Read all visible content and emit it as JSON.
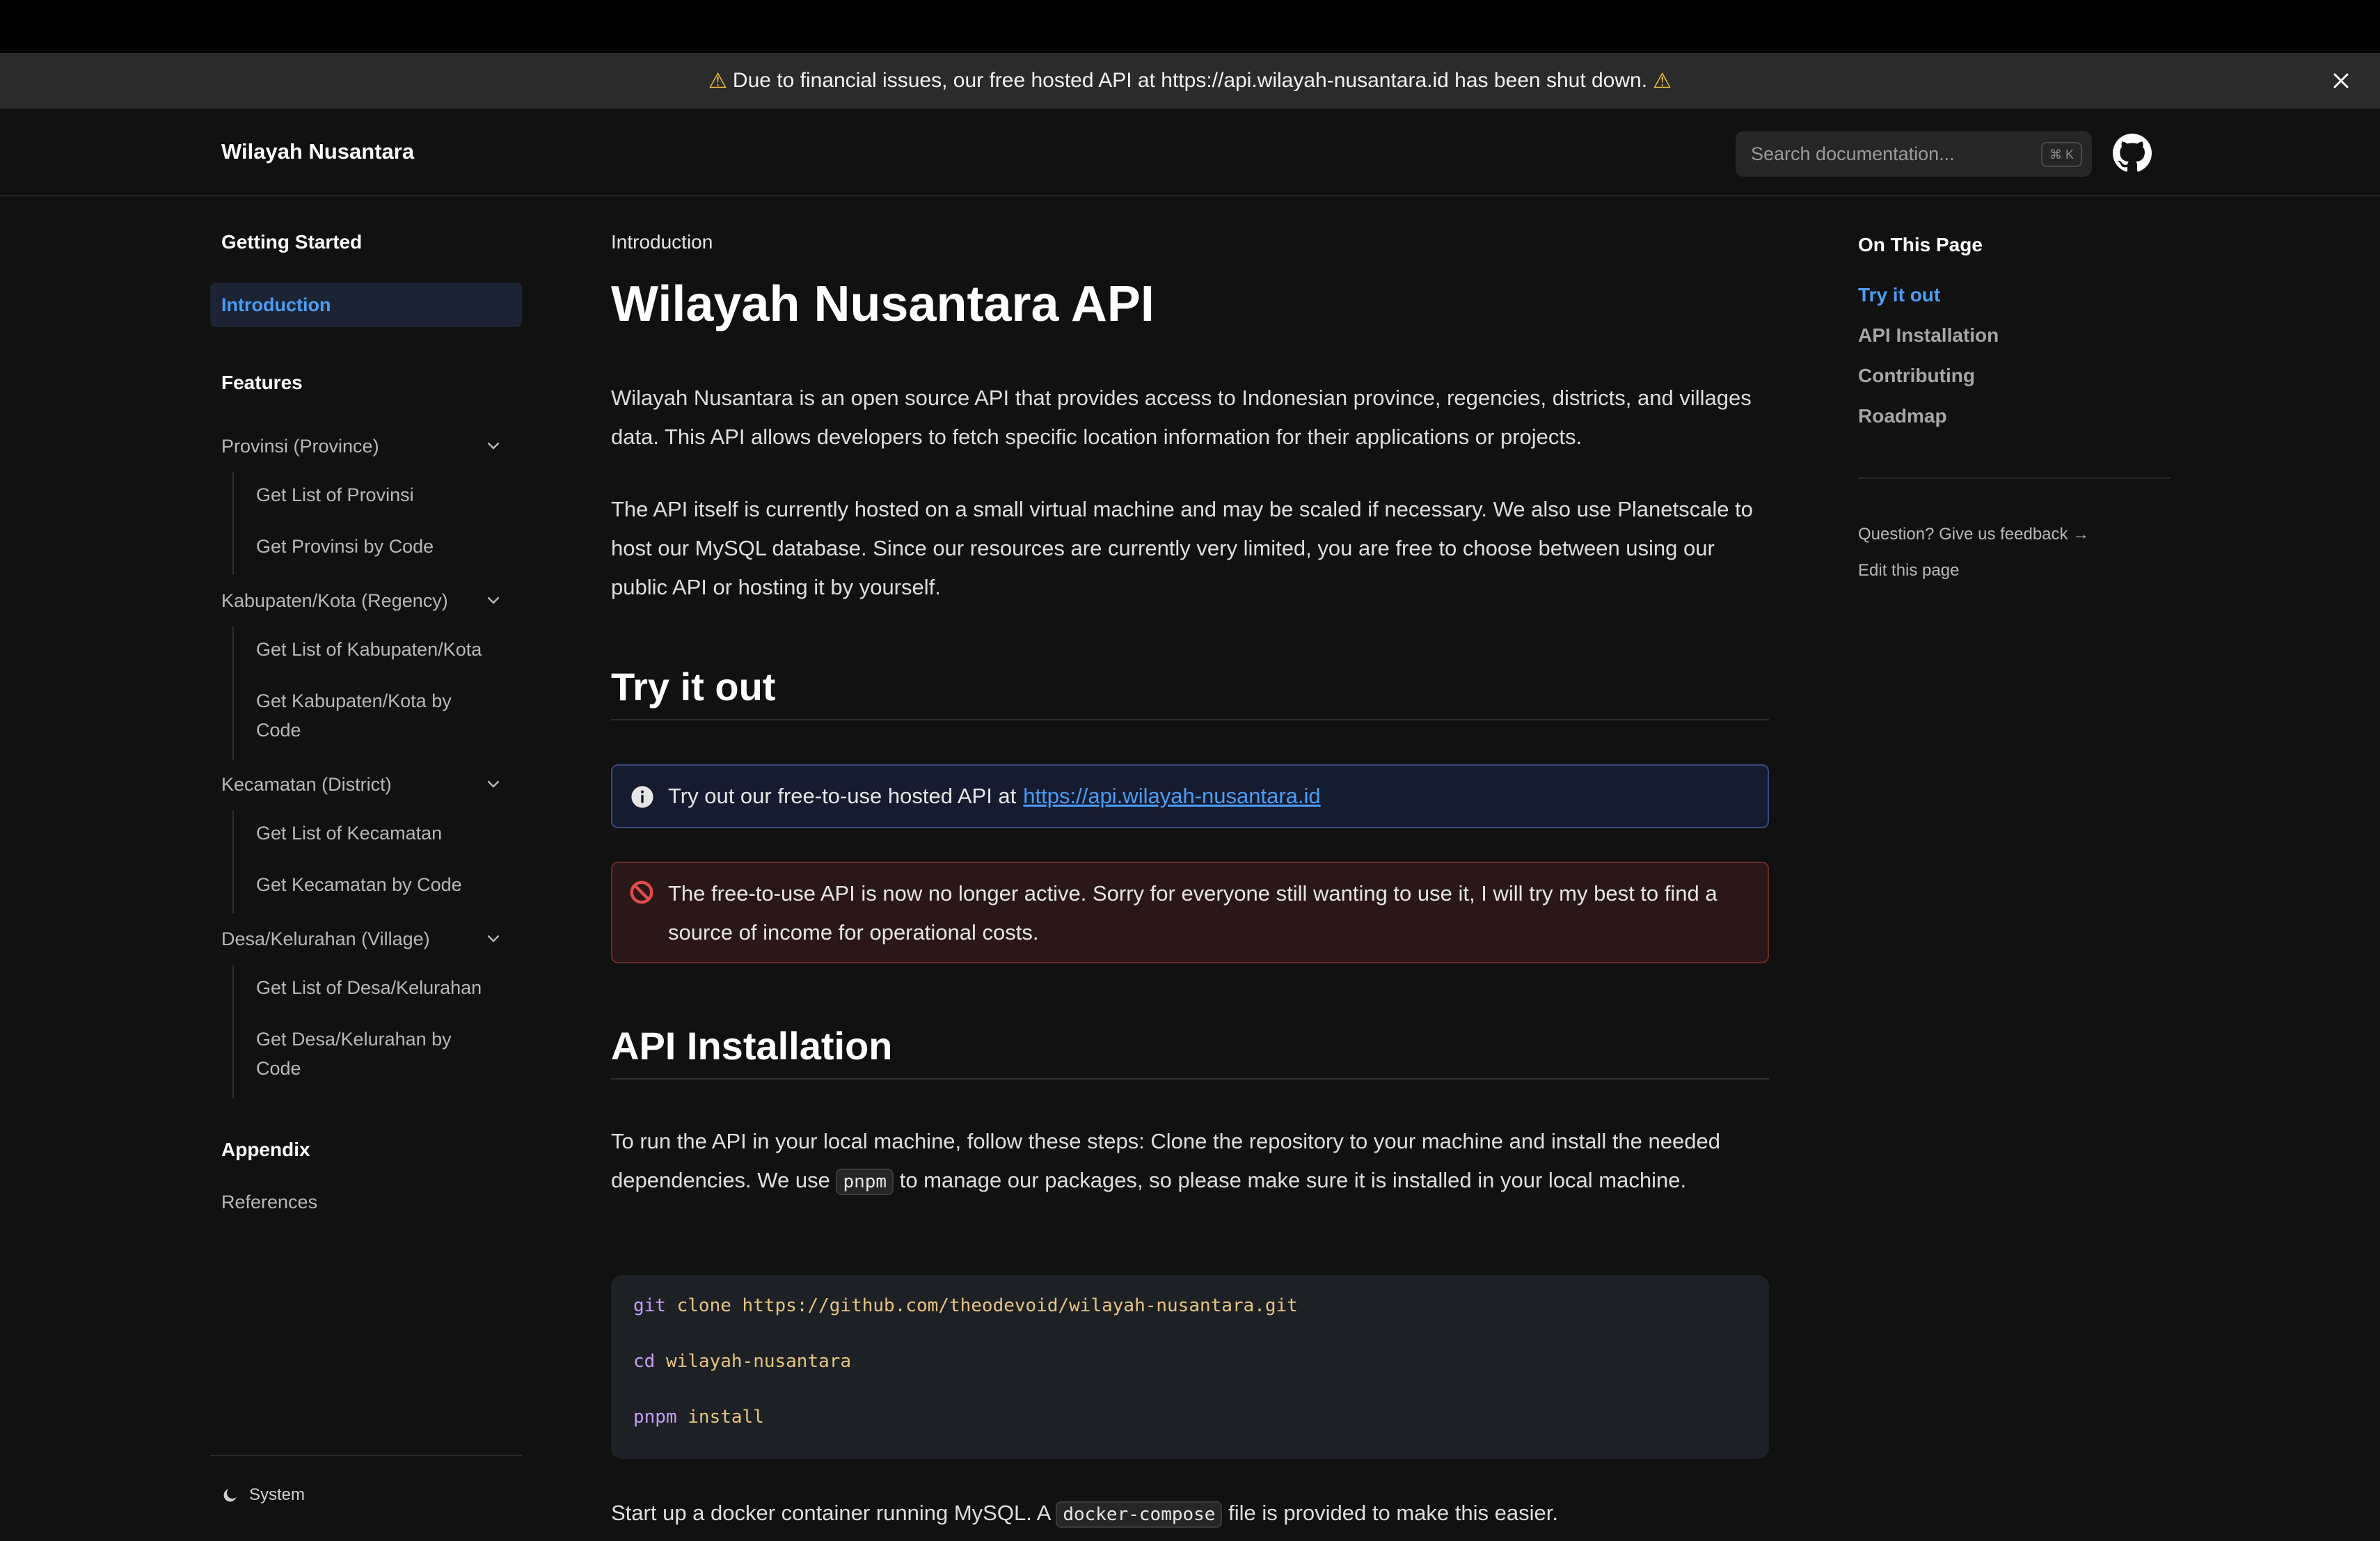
{
  "banner": {
    "warn_icon": "⚠",
    "text": "Due to financial issues, our free hosted API at https://api.wilayah-nusantara.id has been shut down."
  },
  "navbar": {
    "brand": "Wilayah Nusantara",
    "search_placeholder": "Search documentation...",
    "search_shortcut": "⌘ K"
  },
  "sidebar": {
    "getting_started": "Getting Started",
    "introduction": "Introduction",
    "features": "Features",
    "provinsi": "Provinsi (Province)",
    "provinsi_list": "Get List of Provinsi",
    "provinsi_code": "Get Provinsi by Code",
    "kabupaten": "Kabupaten/Kota (Regency)",
    "kabupaten_list": "Get List of Kabupaten/Kota",
    "kabupaten_code": "Get Kabupaten/Kota by Code",
    "kecamatan": "Kecamatan (District)",
    "kecamatan_list": "Get List of Kecamatan",
    "kecamatan_code": "Get Kecamatan by Code",
    "desa": "Desa/Kelurahan (Village)",
    "desa_list": "Get List of Desa/Kelurahan",
    "desa_code": "Get Desa/Kelurahan by Code",
    "appendix": "Appendix",
    "references": "References",
    "theme": "System"
  },
  "main": {
    "breadcrumb": "Introduction",
    "title": "Wilayah Nusantara API",
    "intro_p1": "Wilayah Nusantara is an open source API that provides access to Indonesian province, regencies, districts, and villages data. This API allows developers to fetch specific location information for their applications or projects.",
    "intro_p2": "The API itself is currently hosted on a small virtual machine and may be scaled if necessary. We also use Planetscale to host our MySQL database. Since our resources are currently very limited, you are free to choose between using our public API or hosting it by yourself.",
    "try_heading": "Try it out",
    "info_text": "Try out our free-to-use hosted API at",
    "info_link": "https://api.wilayah-nusantara.id",
    "error_text": "The free-to-use API is now no longer active. Sorry for everyone still wanting to use it, I will try my best to find a source of income for operational costs.",
    "install_heading": "API Installation",
    "install_p_a": "To run the API in your local machine, follow these steps: Clone the repository to your machine and install the needed dependencies. We use",
    "install_code": "pnpm",
    "install_p_b": "to manage our packages, so please make sure it is installed in your local machine.",
    "code": [
      {
        "cmd": "git",
        "args": "clone https://github.com/theodevoid/wilayah-nusantara.git"
      },
      {
        "cmd": "cd",
        "args": "wilayah-nusantara"
      },
      {
        "cmd": "pnpm",
        "args": "install"
      }
    ],
    "docker_p_a": "Start up a docker container running MySQL. A",
    "docker_code": "docker-compose",
    "docker_p_b": "file is provided to make this easier."
  },
  "toc": {
    "title": "On This Page",
    "items": [
      "Try it out",
      "API Installation",
      "Contributing",
      "Roadmap"
    ],
    "feedback": "Question? Give us feedback →",
    "edit": "Edit this page"
  },
  "colors": {
    "accent": "#4b9cf5",
    "background": "#111111",
    "warning": "#f5c542",
    "error_bg": "#2a1718",
    "info_bg": "#161c30"
  }
}
